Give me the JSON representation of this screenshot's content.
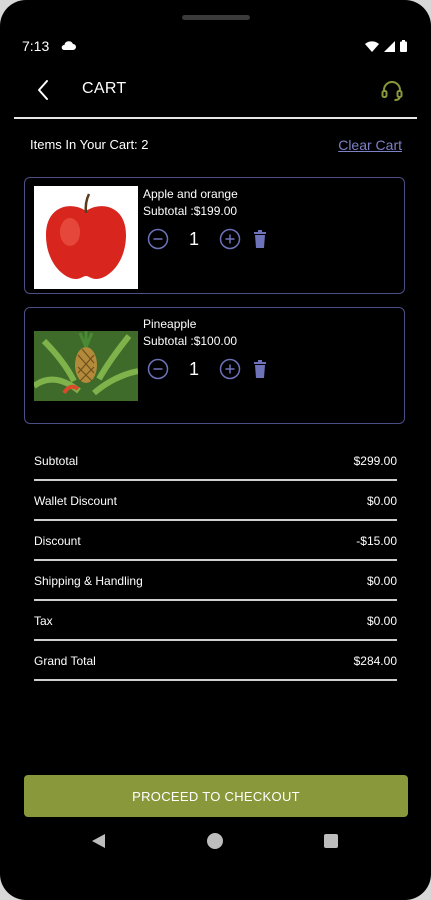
{
  "status_bar": {
    "time": "7:13"
  },
  "app_bar": {
    "title": "CART"
  },
  "cart": {
    "items_count_label": "Items In Your Cart: 2",
    "clear_label": "Clear Cart",
    "items": [
      {
        "name": "Apple and orange",
        "subtotal": "Subtotal :$199.00",
        "quantity": "1"
      },
      {
        "name": "Pineapple",
        "subtotal": "Subtotal :$100.00",
        "quantity": "1"
      }
    ]
  },
  "summary": [
    {
      "label": "Subtotal",
      "value": "$299.00"
    },
    {
      "label": "Wallet Discount",
      "value": "$0.00"
    },
    {
      "label": "Discount",
      "value": "-$15.00"
    },
    {
      "label": "Shipping & Handling",
      "value": "$0.00"
    },
    {
      "label": "Tax",
      "value": "$0.00"
    },
    {
      "label": "Grand Total",
      "value": "$284.00"
    }
  ],
  "checkout_label": "PROCEED TO CHECKOUT",
  "colors": {
    "accent": "#8a983c",
    "link": "#7c80c4",
    "card_border": "#4b4f86",
    "icon_blue": "#6e72b8"
  }
}
